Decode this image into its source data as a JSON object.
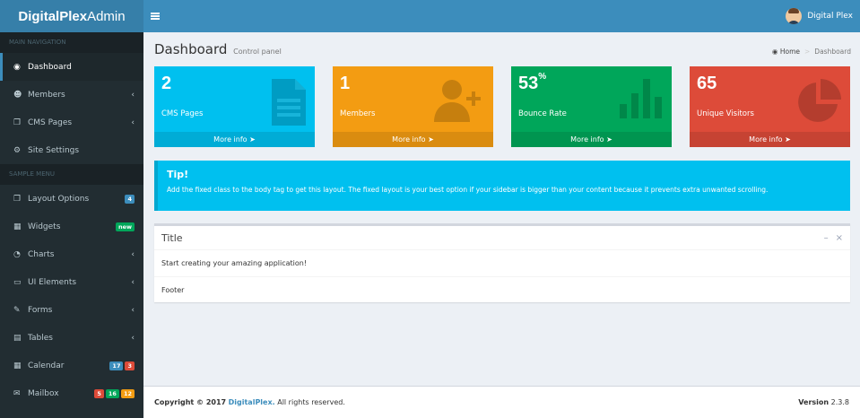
{
  "header": {
    "logo_bold": "DigitalPlex",
    "logo_rest": "Admin",
    "user_name": "Digital Plex"
  },
  "sidebar": {
    "main_header": "MAIN NAVIGATION",
    "main_items": [
      {
        "label": "Dashboard",
        "icon": "dashboard-icon",
        "active": true
      },
      {
        "label": "Members",
        "icon": "users-icon",
        "chevron": true
      },
      {
        "label": "CMS Pages",
        "icon": "copy-icon",
        "chevron": true
      },
      {
        "label": "Site Settings",
        "icon": "cogs-icon"
      }
    ],
    "sample_header": "SAMPLE MENU",
    "sample_items": [
      {
        "label": "Layout Options",
        "icon": "files-icon",
        "badges": [
          {
            "text": "4",
            "color": "#3c8dbc"
          }
        ]
      },
      {
        "label": "Widgets",
        "icon": "th-icon",
        "badges": [
          {
            "text": "new",
            "color": "#00a65a"
          }
        ]
      },
      {
        "label": "Charts",
        "icon": "pie-chart-icon",
        "chevron": true
      },
      {
        "label": "UI Elements",
        "icon": "laptop-icon",
        "chevron": true
      },
      {
        "label": "Forms",
        "icon": "edit-icon",
        "chevron": true
      },
      {
        "label": "Tables",
        "icon": "table-icon",
        "chevron": true
      },
      {
        "label": "Calendar",
        "icon": "calendar-icon",
        "badges": [
          {
            "text": "17",
            "color": "#3c8dbc"
          },
          {
            "text": "3",
            "color": "#dd4b39"
          }
        ]
      },
      {
        "label": "Mailbox",
        "icon": "envelope-icon",
        "badges": [
          {
            "text": "5",
            "color": "#dd4b39"
          },
          {
            "text": "16",
            "color": "#00a65a"
          },
          {
            "text": "12",
            "color": "#f39c12"
          }
        ]
      }
    ]
  },
  "content": {
    "title": "Dashboard",
    "subtitle": "Control panel",
    "breadcrumb": {
      "home": "Home",
      "separator": ">",
      "current": "Dashboard"
    }
  },
  "stats": [
    {
      "value": "2",
      "suffix": "",
      "label": "CMS Pages",
      "more": "More info",
      "color": "#00c0ef",
      "icon": "document-icon"
    },
    {
      "value": "1",
      "suffix": "",
      "label": "Members",
      "more": "More info",
      "color": "#f39c12",
      "icon": "user-plus-icon"
    },
    {
      "value": "53",
      "suffix": "%",
      "label": "Bounce Rate",
      "more": "More info",
      "color": "#00a65a",
      "icon": "bar-chart-icon"
    },
    {
      "value": "65",
      "suffix": "",
      "label": "Unique Visitors",
      "more": "More info",
      "color": "#dd4b39",
      "icon": "pie-chart-icon"
    }
  ],
  "tip": {
    "title": "Tip!",
    "text": "Add the fixed class to the body tag to get this layout. The fixed layout is your best option if your sidebar is bigger than your content because it prevents extra unwanted scrolling."
  },
  "panel": {
    "title": "Title",
    "body": "Start creating your amazing application!",
    "footer": "Footer"
  },
  "footer": {
    "copyright": "Copyright © 2017",
    "brand": "DigitalPlex.",
    "rights": "All rights reserved.",
    "version_label": "Version",
    "version": "2.3.8"
  }
}
